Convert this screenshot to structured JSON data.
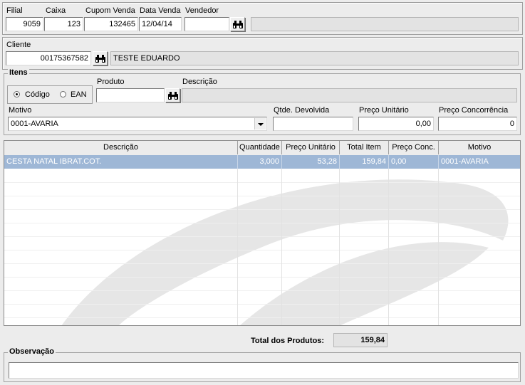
{
  "header": {
    "filial_label": "Filial",
    "filial_value": "9059",
    "caixa_label": "Caixa",
    "caixa_value": "123",
    "cupom_label": "Cupom Venda",
    "cupom_value": "132465",
    "data_label": "Data Venda",
    "data_value": "12/04/14",
    "vendedor_label": "Vendedor",
    "vendedor_value": "",
    "vendedor_name": "",
    "search_icon": "binoculars-icon"
  },
  "cliente": {
    "label": "Cliente",
    "code": "00175367582",
    "name": "TESTE EDUARDO"
  },
  "itens": {
    "title": "Itens",
    "radio_codigo": "Código",
    "radio_ean": "EAN",
    "selected": "Código",
    "produto_label": "Produto",
    "produto_value": "",
    "descricao_label": "Descrição",
    "descricao_value": "",
    "motivo_label": "Motivo",
    "motivo_value": "0001-AVARIA",
    "qtde_label": "Qtde. Devolvida",
    "qtde_value": "",
    "preco_unit_label": "Preço Unitário",
    "preco_unit_value": "0,00",
    "preco_conc_label": "Preço Concorrência",
    "preco_conc_value": "0"
  },
  "grid": {
    "columns": [
      "Descrição",
      "Quantidade",
      "Preço Unitário",
      "Total Item",
      "Preço Conc.",
      "Motivo"
    ],
    "rows": [
      [
        "CESTA NATAL IBRAT.COT.",
        "3,000",
        "53,28",
        "159,84",
        "0,00",
        "0001-AVARIA"
      ]
    ]
  },
  "totals": {
    "label": "Total dos Produtos:",
    "value": "159,84"
  },
  "observacao": {
    "title": "Observação",
    "value": ""
  },
  "colors": {
    "selected_row": "#9eb7d6",
    "window_bg": "#ececec"
  }
}
